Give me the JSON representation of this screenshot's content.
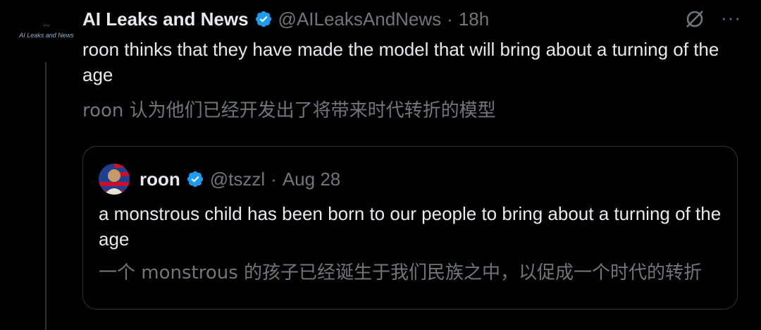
{
  "tweet": {
    "avatar_text": "AI Leaks and News",
    "name": "AI Leaks and News",
    "handle": "@AILeaksAndNews",
    "separator": "·",
    "time": "18h",
    "more_label": "···",
    "text": "roon thinks that they have made the model that will bring about a turning of the age",
    "translation": "roon 认为他们已经开发出了将带来时代转折的模型"
  },
  "quote": {
    "name": "roon",
    "handle": "@tszzl",
    "separator": "·",
    "time": "Aug 28",
    "text": "a monstrous child has been born to our people to bring about a turning of the age",
    "translation": "一个 monstrous 的孩子已经诞生于我们民族之中，以促成一个时代的转折"
  },
  "colors": {
    "background": "#000000",
    "primary_text": "#e7e9ea",
    "secondary_text": "#71767b",
    "verified": "#1d9bf0",
    "border": "#2f3336"
  },
  "icons": {
    "verified": "verified-badge-icon",
    "grok": "grok-icon",
    "more": "more-icon"
  }
}
